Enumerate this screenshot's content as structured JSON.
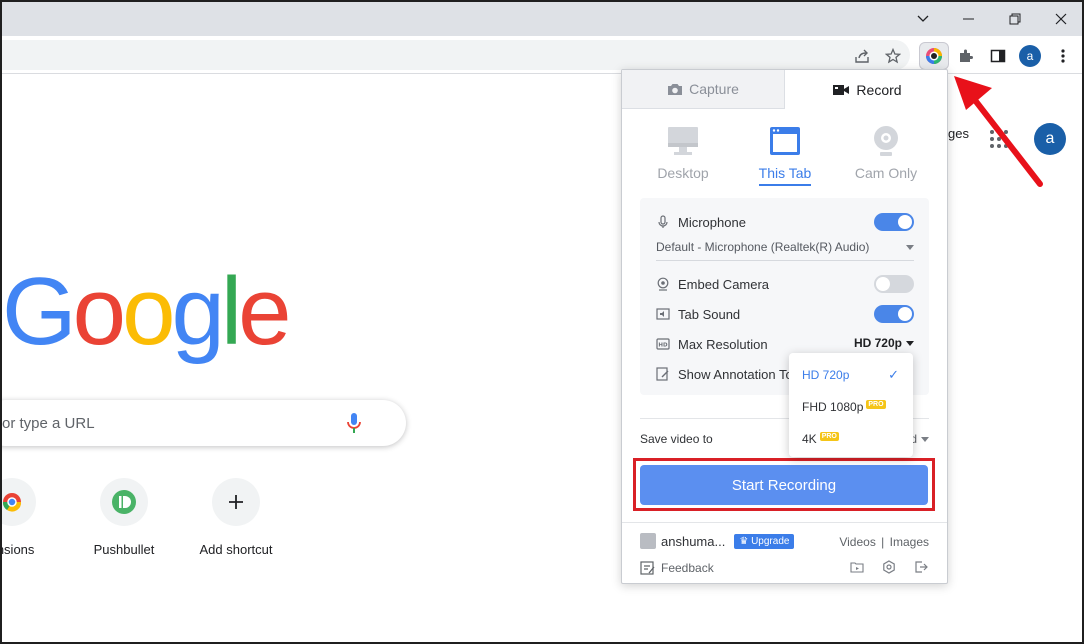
{
  "window": {
    "minimize": "—",
    "restore": "❐",
    "close": "✕",
    "tab_list": "⌄"
  },
  "toolbar": {
    "profile_initial": "a"
  },
  "page": {
    "logo_letters": [
      "G",
      "o",
      "o",
      "g",
      "l",
      "e"
    ],
    "search_placeholder": "or type a URL",
    "right_link": "ges",
    "avatar_initial": "a",
    "shortcuts": [
      {
        "label": "ensions"
      },
      {
        "label": "Pushbullet"
      },
      {
        "label": "Add shortcut"
      }
    ]
  },
  "popup": {
    "tabs": {
      "capture": "Capture",
      "record": "Record"
    },
    "modes": {
      "desktop": "Desktop",
      "this_tab": "This Tab",
      "cam_only": "Cam Only"
    },
    "settings": {
      "microphone": "Microphone",
      "microphone_device": "Default - Microphone (Realtek(R) Audio)",
      "embed_camera": "Embed Camera",
      "tab_sound": "Tab Sound",
      "max_resolution": "Max Resolution",
      "max_resolution_value": "HD 720p",
      "show_annotation": "Show Annotation Too",
      "microphone_on": true,
      "embed_camera_on": false,
      "tab_sound_on": true
    },
    "save_video_to": "Save video to",
    "save_video_value": "d",
    "start_button": "Start Recording",
    "footer": {
      "username": "anshuma...",
      "upgrade": "Upgrade",
      "videos": "Videos",
      "separator": "|",
      "images": "Images",
      "feedback": "Feedback"
    }
  },
  "resolution_menu": {
    "options": [
      {
        "label": "HD 720p",
        "selected": true,
        "pro": ""
      },
      {
        "label": "FHD 1080p",
        "selected": false,
        "pro": "PRO"
      },
      {
        "label": "4K",
        "selected": false,
        "pro": "PRO"
      }
    ],
    "check": "✓"
  },
  "colors": {
    "accent": "#3b7de9",
    "button": "#5b8ff0",
    "highlight_red": "#d92026"
  }
}
